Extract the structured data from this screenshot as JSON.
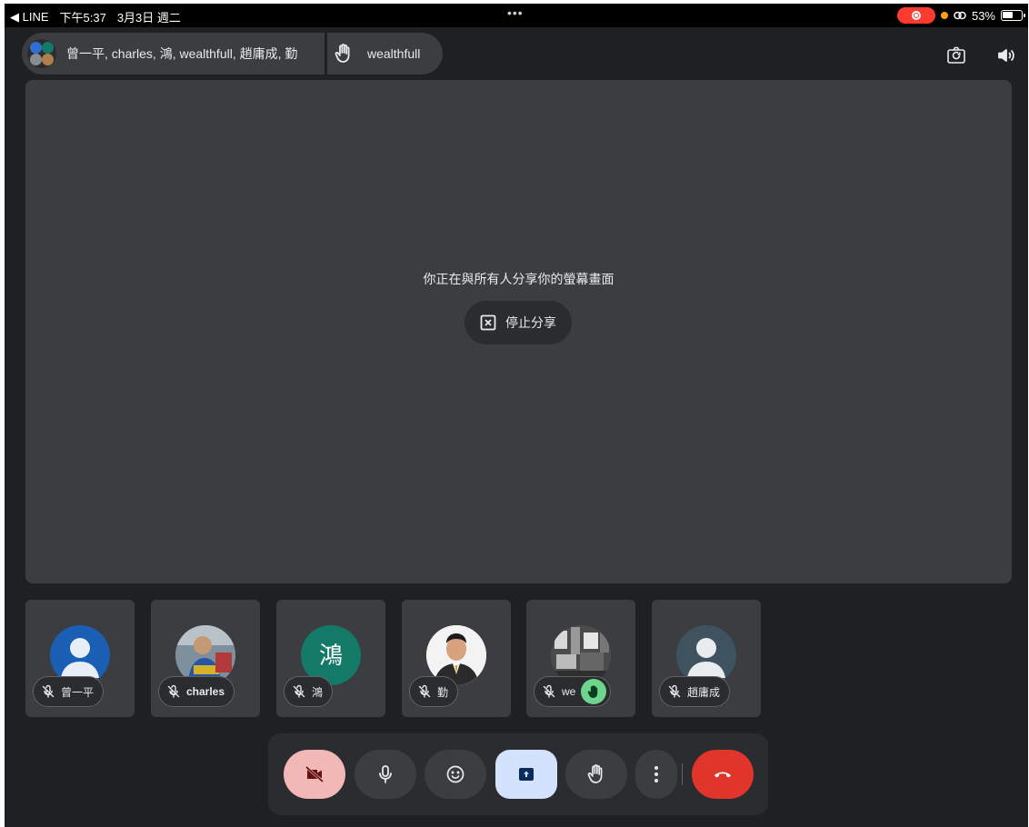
{
  "status_bar": {
    "back_app": "◀ LINE",
    "time": "下午5:37",
    "date": "3月3日 週二",
    "dots": "•••",
    "battery_percent": "53%"
  },
  "top_bar": {
    "participants": "曾一平, charles, 鴻, wealthfull, 趙庸成, 勤",
    "raised_hand_name": "wealthfull"
  },
  "stage": {
    "share_message": "你正在與所有人分享你的螢幕畫面",
    "stop_share_label": "停止分享"
  },
  "tiles": [
    {
      "name": "曾一平",
      "avatar": "default-person-blue"
    },
    {
      "name": "charles",
      "avatar": "photo"
    },
    {
      "name": "鴻",
      "avatar_letter": "鴻",
      "avatar_color": "#137a68"
    },
    {
      "name": "勤",
      "avatar": "photo"
    },
    {
      "name": "we",
      "avatar": "photo",
      "hand_raised": true
    },
    {
      "name": "趙庸成",
      "avatar": "default-person-slate"
    }
  ],
  "controls": {
    "camera_off_color": "#f2b8b5",
    "share_active_color": "#d3e3fd",
    "end_call_color": "#e1352b"
  }
}
